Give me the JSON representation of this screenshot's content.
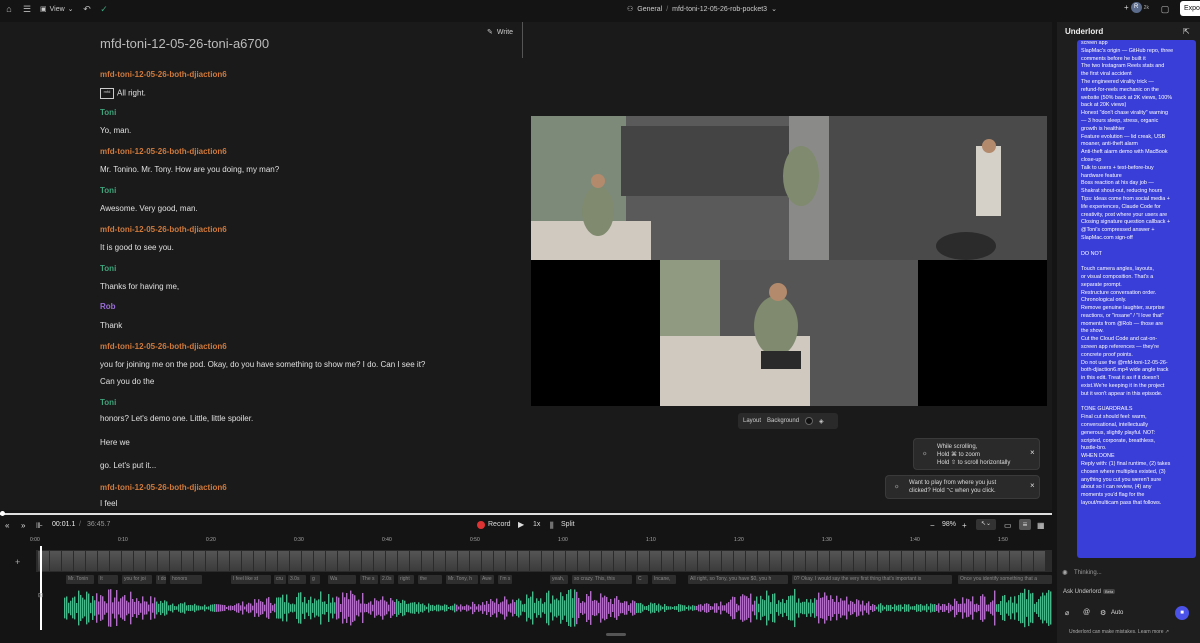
{
  "topbar": {
    "view": "View",
    "workspace": "General",
    "project": "mfd-toni-12-05-26-rob-pocket3",
    "avatar_letter": "R",
    "collab_count": "2k",
    "export": "Expo"
  },
  "editor": {
    "title": "mfd-toni-12-05-26-toni-a6700",
    "write": "Write",
    "lines": [
      {
        "speaker": "mfd-toni-12-05-26-both-djiaction6",
        "kind": "mfd"
      },
      {
        "text": "All right.",
        "marker": "mfd"
      },
      {
        "speaker": "Toni",
        "kind": "toni"
      },
      {
        "text": "Yo, man."
      },
      {
        "speaker": "mfd-toni-12-05-26-both-djiaction6",
        "kind": "mfd"
      },
      {
        "text": "Mr. Tonino. Mr. Tony. How are you doing, my man?"
      },
      {
        "speaker": "Toni",
        "kind": "toni"
      },
      {
        "text": "Awesome. Very good, man."
      },
      {
        "speaker": "mfd-toni-12-05-26-both-djiaction6",
        "kind": "mfd"
      },
      {
        "text": "It is good to see you."
      },
      {
        "speaker": "Toni",
        "kind": "toni"
      },
      {
        "text": "Thanks for having me,"
      },
      {
        "speaker": "Rob",
        "kind": "rob"
      },
      {
        "text": "Thank"
      },
      {
        "speaker": "mfd-toni-12-05-26-both-djiaction6",
        "kind": "mfd"
      },
      {
        "text": "you for joining me on the pod. Okay, do you have something to show me? I do. Can I see it?"
      },
      {
        "text": "Can you do the"
      },
      {
        "speaker": "Toni",
        "kind": "toni"
      },
      {
        "text": "honors? Let's demo one. Little, little spoiler."
      },
      {
        "text": "Here we"
      },
      {
        "text": "go. Let's put it..."
      },
      {
        "speaker": "mfd-toni-12-05-26-both-djiaction6",
        "kind": "mfd"
      },
      {
        "text": "I feel"
      }
    ]
  },
  "viewer": {
    "layout": "Layout",
    "background": "Background",
    "toast1": [
      "While scrolling,",
      "Hold ⌘ to zoom",
      "Hold ⇧ to scroll horizontally"
    ],
    "toast2": [
      "Want to play from where you just",
      "clicked? Hold  ⌥  when you click."
    ]
  },
  "timeline": {
    "current": "00:01.1",
    "total": "36:45.7",
    "record": "Record",
    "speed": "1x",
    "split": "Split",
    "zoom": "98%",
    "ticks": [
      "0:00",
      "0:10",
      "0:20",
      "0:30",
      "0:40",
      "0:50",
      "1:00",
      "1:10",
      "1:20",
      "1:30",
      "1:40",
      "1:50"
    ],
    "captions": [
      "Mr. Tonin",
      "It",
      "you for joi",
      "I do",
      "honors",
      "I feel like st",
      "cru",
      "3.0s",
      "g",
      "Wa",
      "The s",
      "2.0s",
      "right",
      "the",
      "Mr. Tony, h",
      "Awe",
      "I'm s",
      "yeah,",
      "so crazy. This, this",
      "C",
      "Incane,",
      "All right, so Tony, you have $0, you h",
      "0? Okay. I would say the very first thing that's important is",
      "Once you identify something that a"
    ]
  },
  "chat": {
    "title": "Underlord",
    "lines": [
      "screen app",
      "SlapMac's origin — GitHub repo, three",
      "comments before he built it",
      "The two Instagram Reels stats and",
      "the first viral accident",
      "The engineered virality trick —",
      "refund-for-reels mechanic on the",
      "website (50% back at 2K views, 100%",
      "back at 20K views)",
      "Honest \"don't chase virality\" warning",
      "— 3 hours sleep, stress, organic",
      "growth is healthier",
      "Feature evolution — lid creak, USB",
      "moaner, anti-theft alarm",
      "Anti-theft alarm demo with MacBook",
      "close-up",
      "Talk to users + test-before-buy",
      "hardware feature",
      "Boss reaction at his day job —",
      "Shakrat shout-out, reducing hours",
      "Tips: ideas come from social media +",
      "life experiences, Claude Code for",
      "creativity, post where your users are",
      "Closing signature question callback +",
      "@Toni's compressed answer +",
      "SlapMac.com sign-off",
      "",
      "DO NOT",
      "",
      "Touch camera angles, layouts,",
      "or visual composition. That's a",
      "separate prompt.",
      "Restructure conversation order.",
      "Chronological only.",
      "Remove genuine laughter, surprise",
      "reactions, or \"insane\" / \"I love that\"",
      "moments from @Rob — those are",
      "the show.",
      "Cut the Cloud Code and cat-on-",
      "screen app references — they're",
      "concrete proof points.",
      "Do not use the @mfd-toni-12-05-26-",
      "both-djiaction6.mp4 wide angle track",
      "in this edit. Treat it as if it doesn't",
      "exist.We're keeping it in the project",
      "but it won't appear in this episode.",
      "",
      "TONE GUARDRAILS",
      "Final cut should feel: warm,",
      "conversational, intellectually",
      "generous, slightly playful. NOT:",
      "scripted, corporate, breathless,",
      "hustle-bro.",
      "WHEN DONE",
      "Reply with: (1) final runtime, (2) takes",
      "chosen where multiples existed, (3)",
      "anything you cut you weren't sure",
      "about so I can review, (4) any",
      "moments you'd flag for the",
      "layout/multicam pass that follows."
    ],
    "thinking": "Thinking...",
    "ask": "Ask Underlord",
    "beta": "Beta",
    "auto": "Auto",
    "footer": "Underlord can make mistakes. Learn more ↗"
  }
}
